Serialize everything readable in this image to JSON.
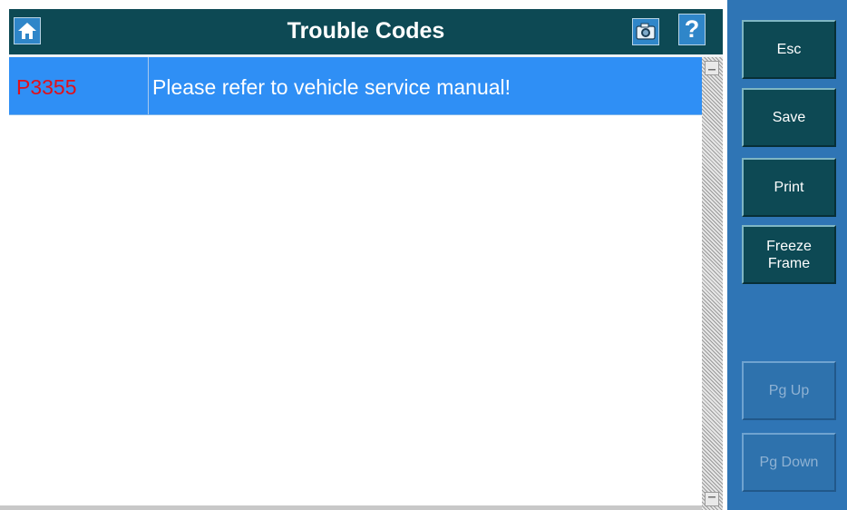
{
  "header": {
    "title": "Trouble Codes",
    "home_icon": "home-icon",
    "camera_icon": "camera-icon",
    "help_label": "?"
  },
  "codes": [
    {
      "code": "P3355",
      "description": "Please refer to vehicle service manual!"
    }
  ],
  "side_buttons": {
    "esc": "Esc",
    "save": "Save",
    "print": "Print",
    "freeze_frame": "Freeze\nFrame",
    "pg_up": "Pg Up",
    "pg_down": "Pg Down"
  },
  "colors": {
    "title_bar": "#0d4954",
    "selected_row": "#2f8ff5",
    "code_text": "#e0101a",
    "side_panel": "#2f75b5",
    "button": "#0d4954"
  }
}
